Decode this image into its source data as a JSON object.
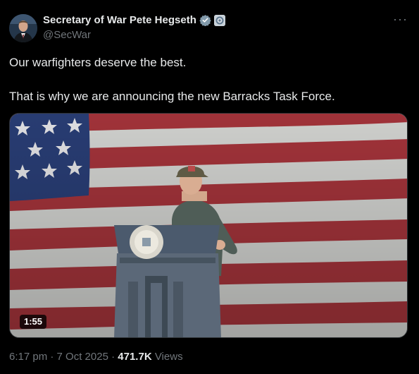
{
  "author": {
    "display_name": "Secretary of War Pete Hegseth",
    "handle": "@SecWar",
    "verified_color": "#829aab",
    "avatar_icon": "profile-photo"
  },
  "more_label": "···",
  "tweet": {
    "line1": "Our warfighters deserve the best.",
    "line2": "That is why we are announcing the new Barracks Task Force."
  },
  "media": {
    "type": "video",
    "duration": "1:55"
  },
  "meta": {
    "time": "6:17 pm",
    "separator": "·",
    "date": "7 Oct 2025",
    "views_count": "471.7K",
    "views_label": "Views"
  },
  "colors": {
    "background": "#000000",
    "text": "#e7e9ea",
    "secondary": "#71767b"
  }
}
